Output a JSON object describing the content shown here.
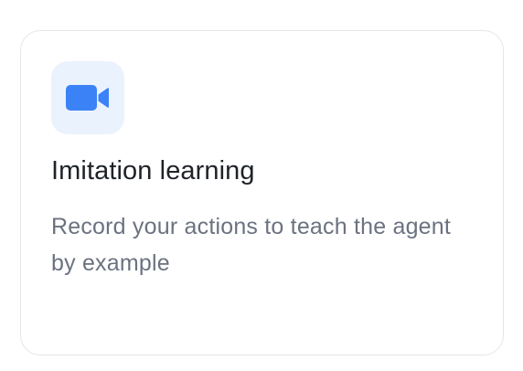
{
  "card": {
    "title": "Imitation learning",
    "description": "Record your actions to teach the agent by example",
    "icon": "video-camera-icon",
    "colors": {
      "icon_background": "#eaf2fe",
      "icon": "#3b82f6",
      "title": "#1f2328",
      "description": "#6b7280",
      "border": "#e4e6ea"
    }
  }
}
